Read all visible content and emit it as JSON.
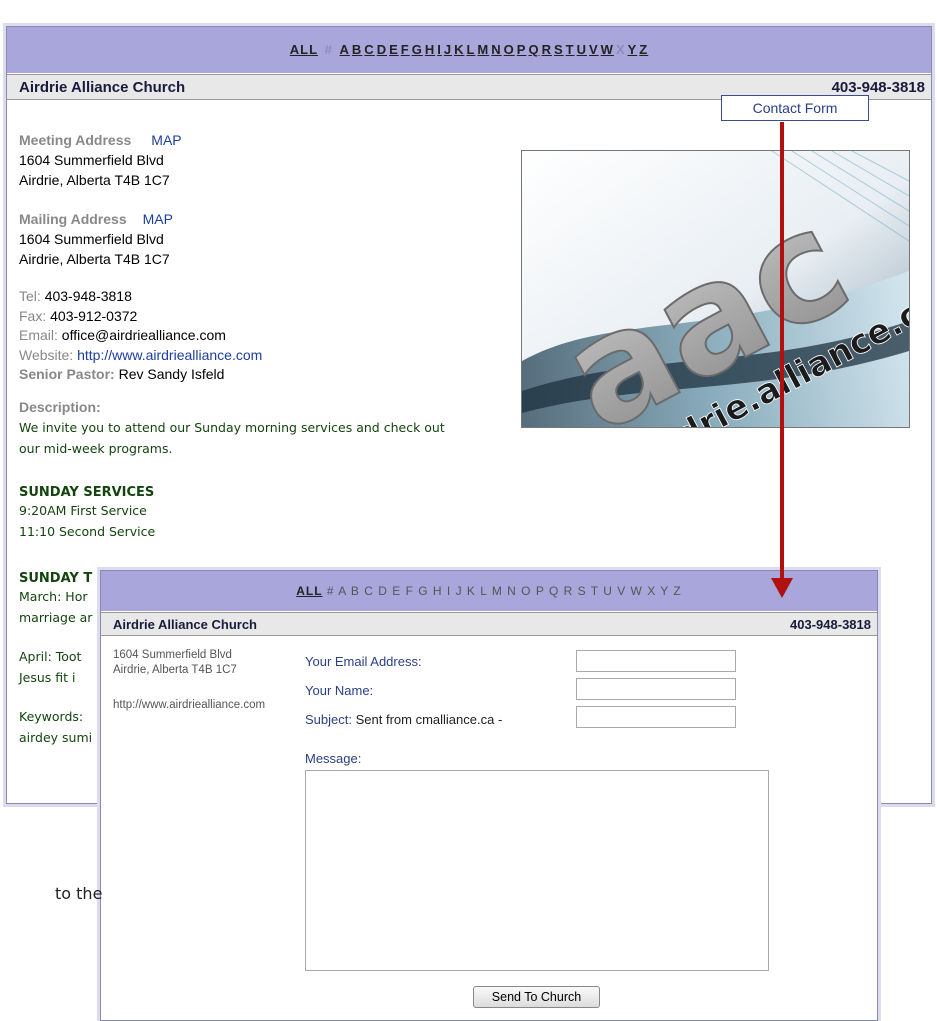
{
  "alphabet": {
    "all": "ALL",
    "hash": "#",
    "letters": [
      "A",
      "B",
      "C",
      "D",
      "E",
      "F",
      "G",
      "H",
      "I",
      "J",
      "K",
      "L",
      "M",
      "N",
      "O",
      "P",
      "Q",
      "R",
      "S",
      "T",
      "U",
      "V",
      "W",
      "X",
      "Y",
      "Z"
    ],
    "front_row": "A B C D E F G H I J K L M N O P Q R S T U V W X Y Z"
  },
  "listing": {
    "name": "Airdrie Alliance Church",
    "phone": "403-948-3818",
    "contact_button": "Contact Form",
    "meeting_label": "Meeting Address",
    "mailing_label": "Mailing Address",
    "map_link": "MAP",
    "address_line1": "1604 Summerfield Blvd",
    "address_line2": "Airdrie, Alberta T4B 1C7",
    "tel_label": "Tel:",
    "tel": "403-948-3818",
    "fax_label": "Fax:",
    "fax": "403-912-0372",
    "email_label": "Email:",
    "email": "office@airdriealliance.com",
    "website_label": "Website:",
    "website": "http://www.airdriealliance.com",
    "pastor_label": "Senior Pastor:",
    "pastor": "Rev Sandy Isfeld",
    "description_label": "Description:",
    "description_line1": "We invite you to attend our Sunday morning services and check out",
    "description_line2": "our mid-week programs.",
    "services_heading": "SUNDAY SERVICES",
    "service1": "9:20AM First Service",
    "service2": "11:10 Second Service",
    "sunday_partial": "SUNDAY T",
    "march_partial": "March: Hor",
    "marriage_partial": "marriage ar",
    "april_partial": "April: Toot",
    "jesus_partial": "Jesus fit i",
    "keywords_partial": "Keywords:",
    "airdey_partial": "airdey sumi"
  },
  "logo": {
    "big_text": "aac",
    "url_text": "airdrie.alliance.church"
  },
  "contact_form": {
    "address_line1": "1604 Summerfield Blvd",
    "address_line2": "Airdrie, Alberta T4B 1C7",
    "website": "http://www.airdriealliance.com",
    "email_label": "Your Email Address:",
    "name_label": "Your Name:",
    "subject_label": "Subject:",
    "subject_value": "Sent from cmalliance.ca -",
    "message_label": "Message:",
    "send_button": "Send To Church"
  },
  "caption_fragment": "to the",
  "colors": {
    "nav_bar": "#a9a6dc",
    "header_bar": "#e8e8e8",
    "link": "#1d3e9e",
    "arrow": "#b01010"
  }
}
